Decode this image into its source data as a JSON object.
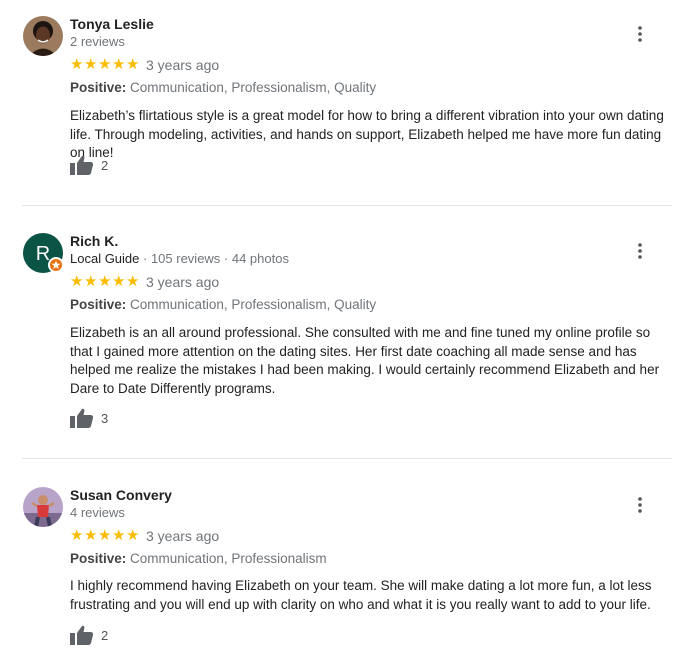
{
  "reviews": [
    {
      "name": "Tonya Leslie",
      "meta": "2 reviews",
      "guide": "",
      "date": "3 years ago",
      "positive_label": "Positive:",
      "positive_values": "Communication, Professionalism, Quality",
      "text": "Elizabeth’s flirtatious style is a great model for how to bring a different vibration into your own dating life. Through modeling, activities, and hands on support, Elizabeth helped me have more fun dating on line!",
      "likes": "2",
      "rating": 5
    },
    {
      "name": "Rich K.",
      "guide": "Local Guide",
      "meta": " · 105 reviews · 44 photos",
      "date": "3 years ago",
      "positive_label": "Positive:",
      "positive_values": "Communication, Professionalism, Quality",
      "text": "Elizabeth is an all around professional.  She consulted with me and fine tuned my online profile so that I gained more attention on the dating sites. Her first date coaching all made sense and has helped me realize the mistakes I had been making. I would certainly recommend Elizabeth and her Dare to Date Differently programs.",
      "likes": "3",
      "avatar_letter": "R",
      "avatar_color": "#0b5345",
      "rating": 5
    },
    {
      "name": "Susan Convery",
      "meta": "4 reviews",
      "guide": "",
      "date": "3 years ago",
      "positive_label": "Positive:",
      "positive_values": "Communication, Professionalism",
      "text": "I highly recommend having Elizabeth on your team.  She will make dating a lot more fun, a lot less frustrating and you will end up with clarity on who and what it is you really want to add to your life.",
      "likes": "2",
      "rating": 5
    }
  ],
  "colors": {
    "star": "#fbbc04",
    "muted": "#70757a",
    "badge": "#e8710a"
  },
  "icons": {
    "star": "★",
    "more": "more-vert-icon",
    "like": "thumb-up-icon"
  }
}
